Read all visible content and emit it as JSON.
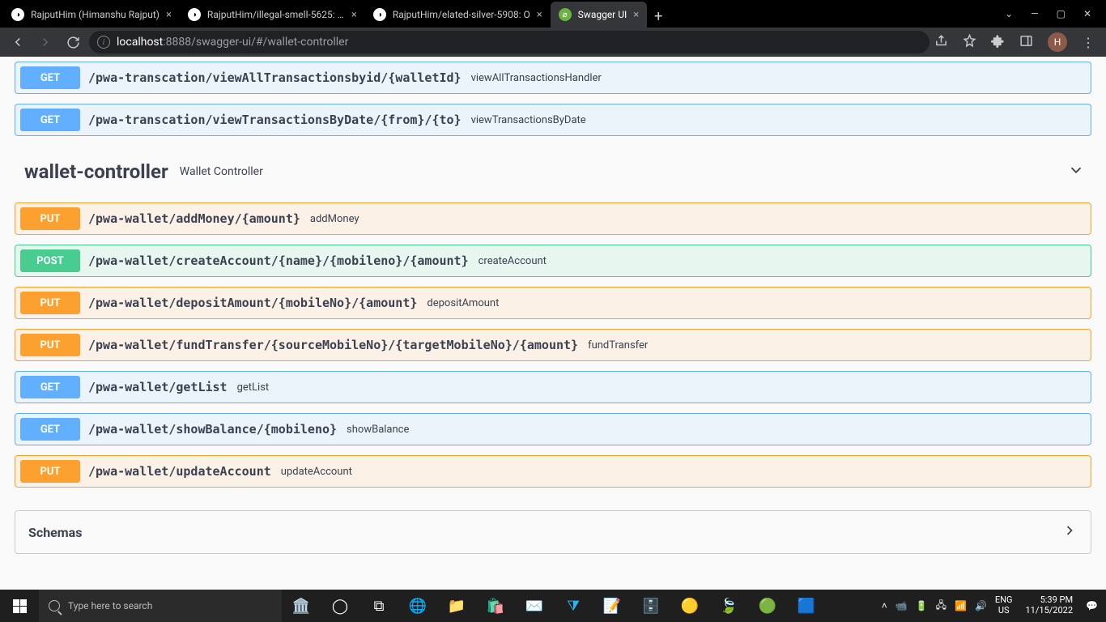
{
  "browser": {
    "tabs": [
      {
        "title": "RajputHim (Himanshu Rajput)",
        "favicon": "gh",
        "active": false
      },
      {
        "title": "RajputHim/illegal-smell-5625: Ha",
        "favicon": "gh",
        "active": false
      },
      {
        "title": "RajputHim/elated-silver-5908: O",
        "favicon": "gh",
        "active": false
      },
      {
        "title": "Swagger UI",
        "favicon": "sw",
        "active": true
      }
    ],
    "url_host": "localhost",
    "url_port": ":8888",
    "url_path": "/swagger-ui/#/wallet-controller"
  },
  "endpoints_top": [
    {
      "method": "GET",
      "path": "/pwa-transcation/viewAllTransactionsbyid/{walletId}",
      "desc": "viewAllTransactionsHandler"
    },
    {
      "method": "GET",
      "path": "/pwa-transcation/viewTransactionsByDate/{from}/{to}",
      "desc": "viewTransactionsByDate"
    }
  ],
  "controller": {
    "name": "wallet-controller",
    "subtitle": "Wallet Controller"
  },
  "endpoints_wallet": [
    {
      "method": "PUT",
      "path": "/pwa-wallet/addMoney/{amount}",
      "desc": "addMoney"
    },
    {
      "method": "POST",
      "path": "/pwa-wallet/createAccount/{name}/{mobileno}/{amount}",
      "desc": "createAccount"
    },
    {
      "method": "PUT",
      "path": "/pwa-wallet/depositAmount/{mobileNo}/{amount}",
      "desc": "depositAmount"
    },
    {
      "method": "PUT",
      "path": "/pwa-wallet/fundTransfer/{sourceMobileNo}/{targetMobileNo}/{amount}",
      "desc": "fundTransfer"
    },
    {
      "method": "GET",
      "path": "/pwa-wallet/getList",
      "desc": "getList"
    },
    {
      "method": "GET",
      "path": "/pwa-wallet/showBalance/{mobileno}",
      "desc": "showBalance"
    },
    {
      "method": "PUT",
      "path": "/pwa-wallet/updateAccount",
      "desc": "updateAccount"
    }
  ],
  "schemas_title": "Schemas",
  "taskbar": {
    "search_placeholder": "Type here to search",
    "lang_top": "ENG",
    "lang_bot": "US",
    "time": "5:39 PM",
    "date": "11/15/2022"
  },
  "avatar_letter": "H"
}
